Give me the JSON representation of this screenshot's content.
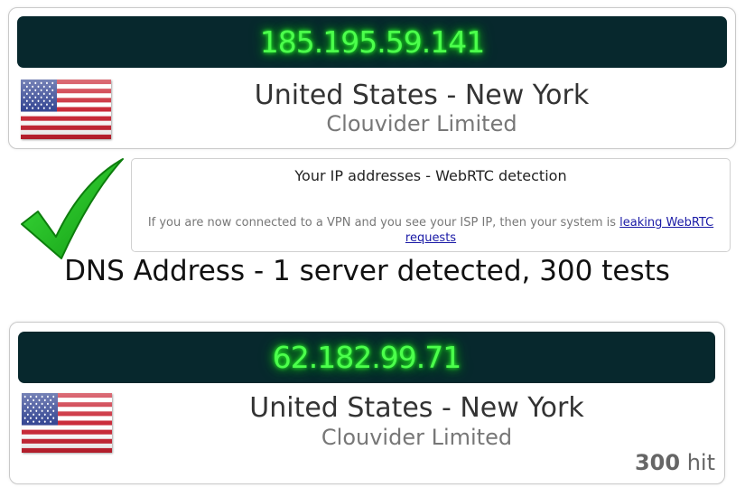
{
  "ip_result": {
    "ip": "185.195.59.141",
    "location": "United States - New York",
    "isp": "Clouvider Limited",
    "flag": "us-flag-icon"
  },
  "webrtc": {
    "title": "Your IP addresses - WebRTC detection",
    "message": "If you are now connected to a VPN and you see your ISP IP, then your system is ",
    "link_text": "leaking WebRTC requests",
    "status_icon": "check-icon"
  },
  "dns": {
    "heading": "DNS Address - 1 server detected, 300 tests",
    "server": {
      "ip": "62.182.99.71",
      "location": "United States - New York",
      "isp": "Clouvider Limited",
      "flag": "us-flag-icon",
      "hit_count": "300",
      "hit_label": "hit"
    }
  },
  "colors": {
    "display_bg": "#07282d",
    "display_text": "#4cff4c",
    "check_green": "#1fc21f",
    "link": "#1a1aa6"
  }
}
